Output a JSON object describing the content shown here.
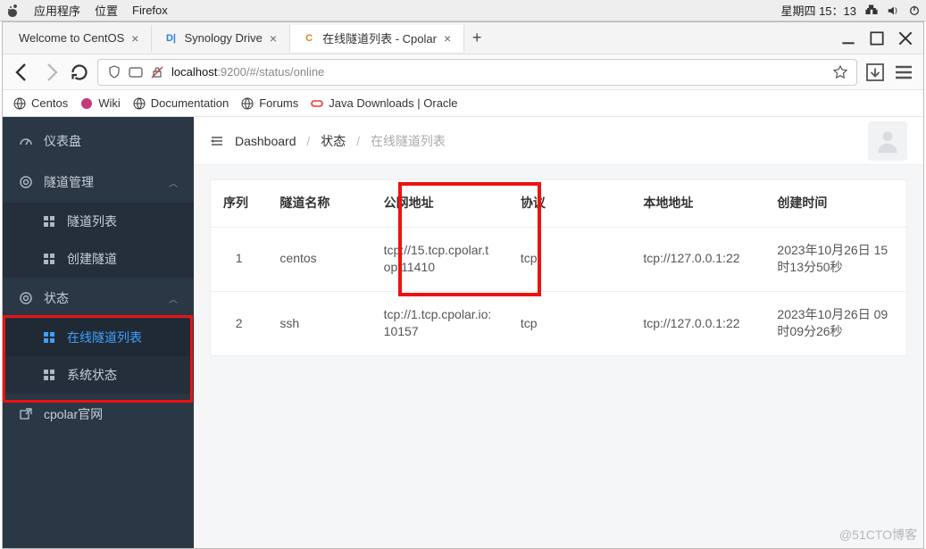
{
  "menubar": {
    "items": [
      "应用程序",
      "位置",
      "Firefox"
    ],
    "clock": "星期四 15：13"
  },
  "tabs": [
    {
      "title": "Welcome to CentOS"
    },
    {
      "title": "Synology Drive"
    },
    {
      "title": "在线隧道列表 - Cpolar"
    }
  ],
  "url": {
    "host": "localhost",
    "rest": ":9200/#/status/online"
  },
  "bookmarks": [
    {
      "label": "Centos"
    },
    {
      "label": "Wiki"
    },
    {
      "label": "Documentation"
    },
    {
      "label": "Forums"
    },
    {
      "label": "Java Downloads | Oracle"
    }
  ],
  "sidebar": {
    "dashboard": "仪表盘",
    "tunnel_mgmt": "隧道管理",
    "tunnel_list": "隧道列表",
    "tunnel_create": "创建隧道",
    "status": "状态",
    "online_list": "在线隧道列表",
    "sys_status": "系统状态",
    "official": "cpolar官网"
  },
  "breadcrumb": {
    "root": "Dashboard",
    "mid": "状态",
    "leaf": "在线隧道列表"
  },
  "table": {
    "cols": {
      "idx": "序列",
      "name": "隧道名称",
      "pub": "公网地址",
      "proto": "协议",
      "local": "本地地址",
      "time": "创建时间"
    },
    "rows": [
      {
        "idx": "1",
        "name": "centos",
        "pub": "tcp://15.tcp.cpolar.top:11410",
        "proto": "tcp",
        "local": "tcp://127.0.0.1:22",
        "time": "2023年10月26日 15时13分50秒"
      },
      {
        "idx": "2",
        "name": "ssh",
        "pub": "tcp://1.tcp.cpolar.io:10157",
        "proto": "tcp",
        "local": "tcp://127.0.0.1:22",
        "time": "2023年10月26日 09时09分26秒"
      }
    ]
  },
  "watermark": "@51CTO博客"
}
